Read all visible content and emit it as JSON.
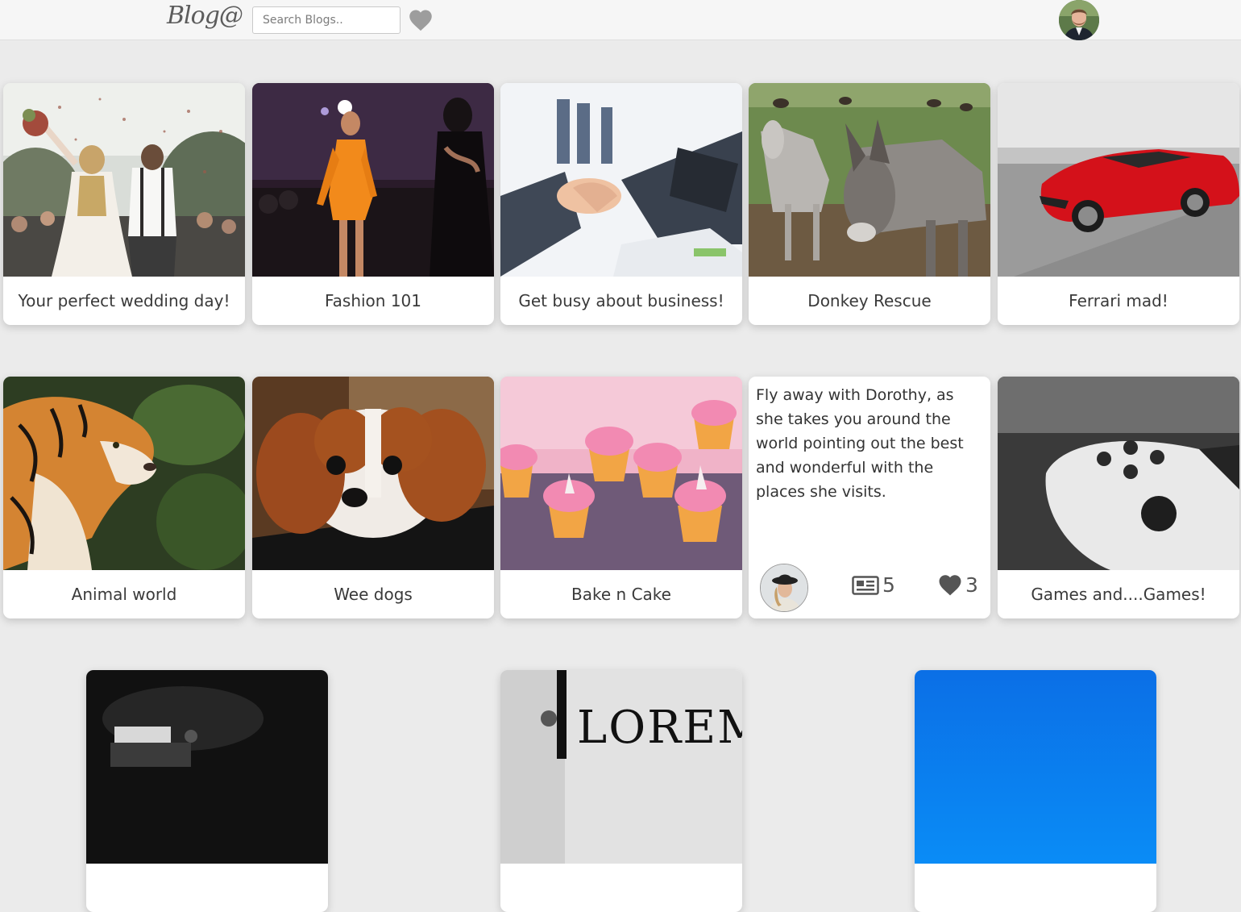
{
  "header": {
    "logo_text": "Blog@",
    "search_placeholder": "Search Blogs..",
    "heart_icon": "heart-icon",
    "profile_icon": "user-avatar"
  },
  "colors": {
    "page_bg": "#ebebeb",
    "header_bg": "#f6f6f6",
    "card_bg": "#ffffff",
    "text": "#3a3a3a",
    "heart": "#9a9a9a"
  },
  "cards": [
    {
      "title": "Your perfect wedding day!",
      "image": "wedding-photo"
    },
    {
      "title": "Fashion 101",
      "image": "fashion-runway-photo"
    },
    {
      "title": "Get busy about business!",
      "image": "business-handshake-photo"
    },
    {
      "title": "Donkey Rescue",
      "image": "donkey-photo"
    },
    {
      "title": "Ferrari mad!",
      "image": "red-ferrari-photo"
    },
    {
      "title": "Animal world",
      "image": "tiger-photo"
    },
    {
      "title": "Wee dogs",
      "image": "puppy-photo"
    },
    {
      "title": "Bake n Cake",
      "image": "cupcakes-photo"
    },
    {
      "title": "",
      "description": "Fly away with Dorothy, as she takes you around the world pointing out the best and wonderful with the places she visits.",
      "posts_count": "5",
      "likes_count": "3",
      "author_avatar": "author-avatar",
      "posts_icon": "newspaper-icon",
      "likes_icon": "heart-icon"
    },
    {
      "title": "Games and....Games!",
      "image": "game-controller-photo"
    },
    {
      "title": "",
      "image": "spotlight-photo"
    },
    {
      "title": "",
      "image": "lorem-ipsum-photo"
    },
    {
      "title": "",
      "image": "blue-gradient-photo"
    }
  ]
}
